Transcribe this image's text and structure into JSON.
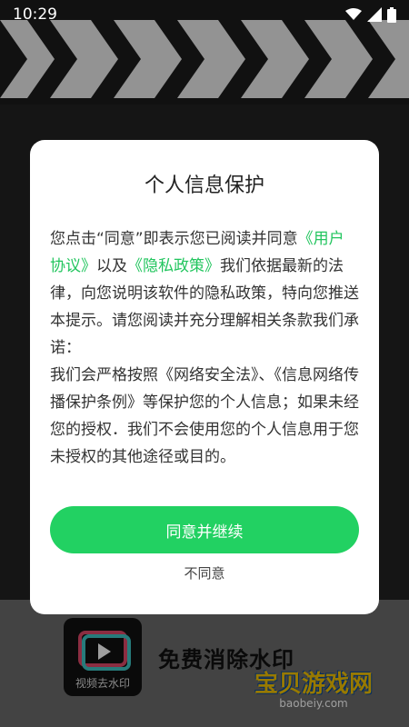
{
  "status_bar": {
    "time": "10:29"
  },
  "dialog": {
    "title": "个人信息保护",
    "text_1": "您点击“同意”即表示您已阅读并同意",
    "link_user_agreement": "《用户协议》",
    "text_2": "以及",
    "link_privacy_policy": "《隐私政策》",
    "text_3": "我们依据最新的法律，向您说明该软件的隐私政策，特向您推送本提示。请您阅读并充分理解相关条款我们承诺：",
    "text_4": "我们会严格按照《网络安全法》、《信息网络传播保护条例》等保护您的个人信息；如果未经您的授权．我们不会使用您的个人信息用于您未授权的其他途径或目的。",
    "agree_button": "同意并继续",
    "disagree_button": "不同意"
  },
  "background": {
    "app_icon_label": "视频去水印",
    "app_title": "免费消除水印",
    "watermark_cn": "宝贝游戏网",
    "watermark_en": "baobeiy.com"
  },
  "colors": {
    "accent": "#22d162",
    "link": "#22c55e",
    "dialog_bg": "#ffffff"
  },
  "icons": [
    "wifi-icon",
    "signal-icon",
    "battery-icon",
    "video-icon"
  ]
}
